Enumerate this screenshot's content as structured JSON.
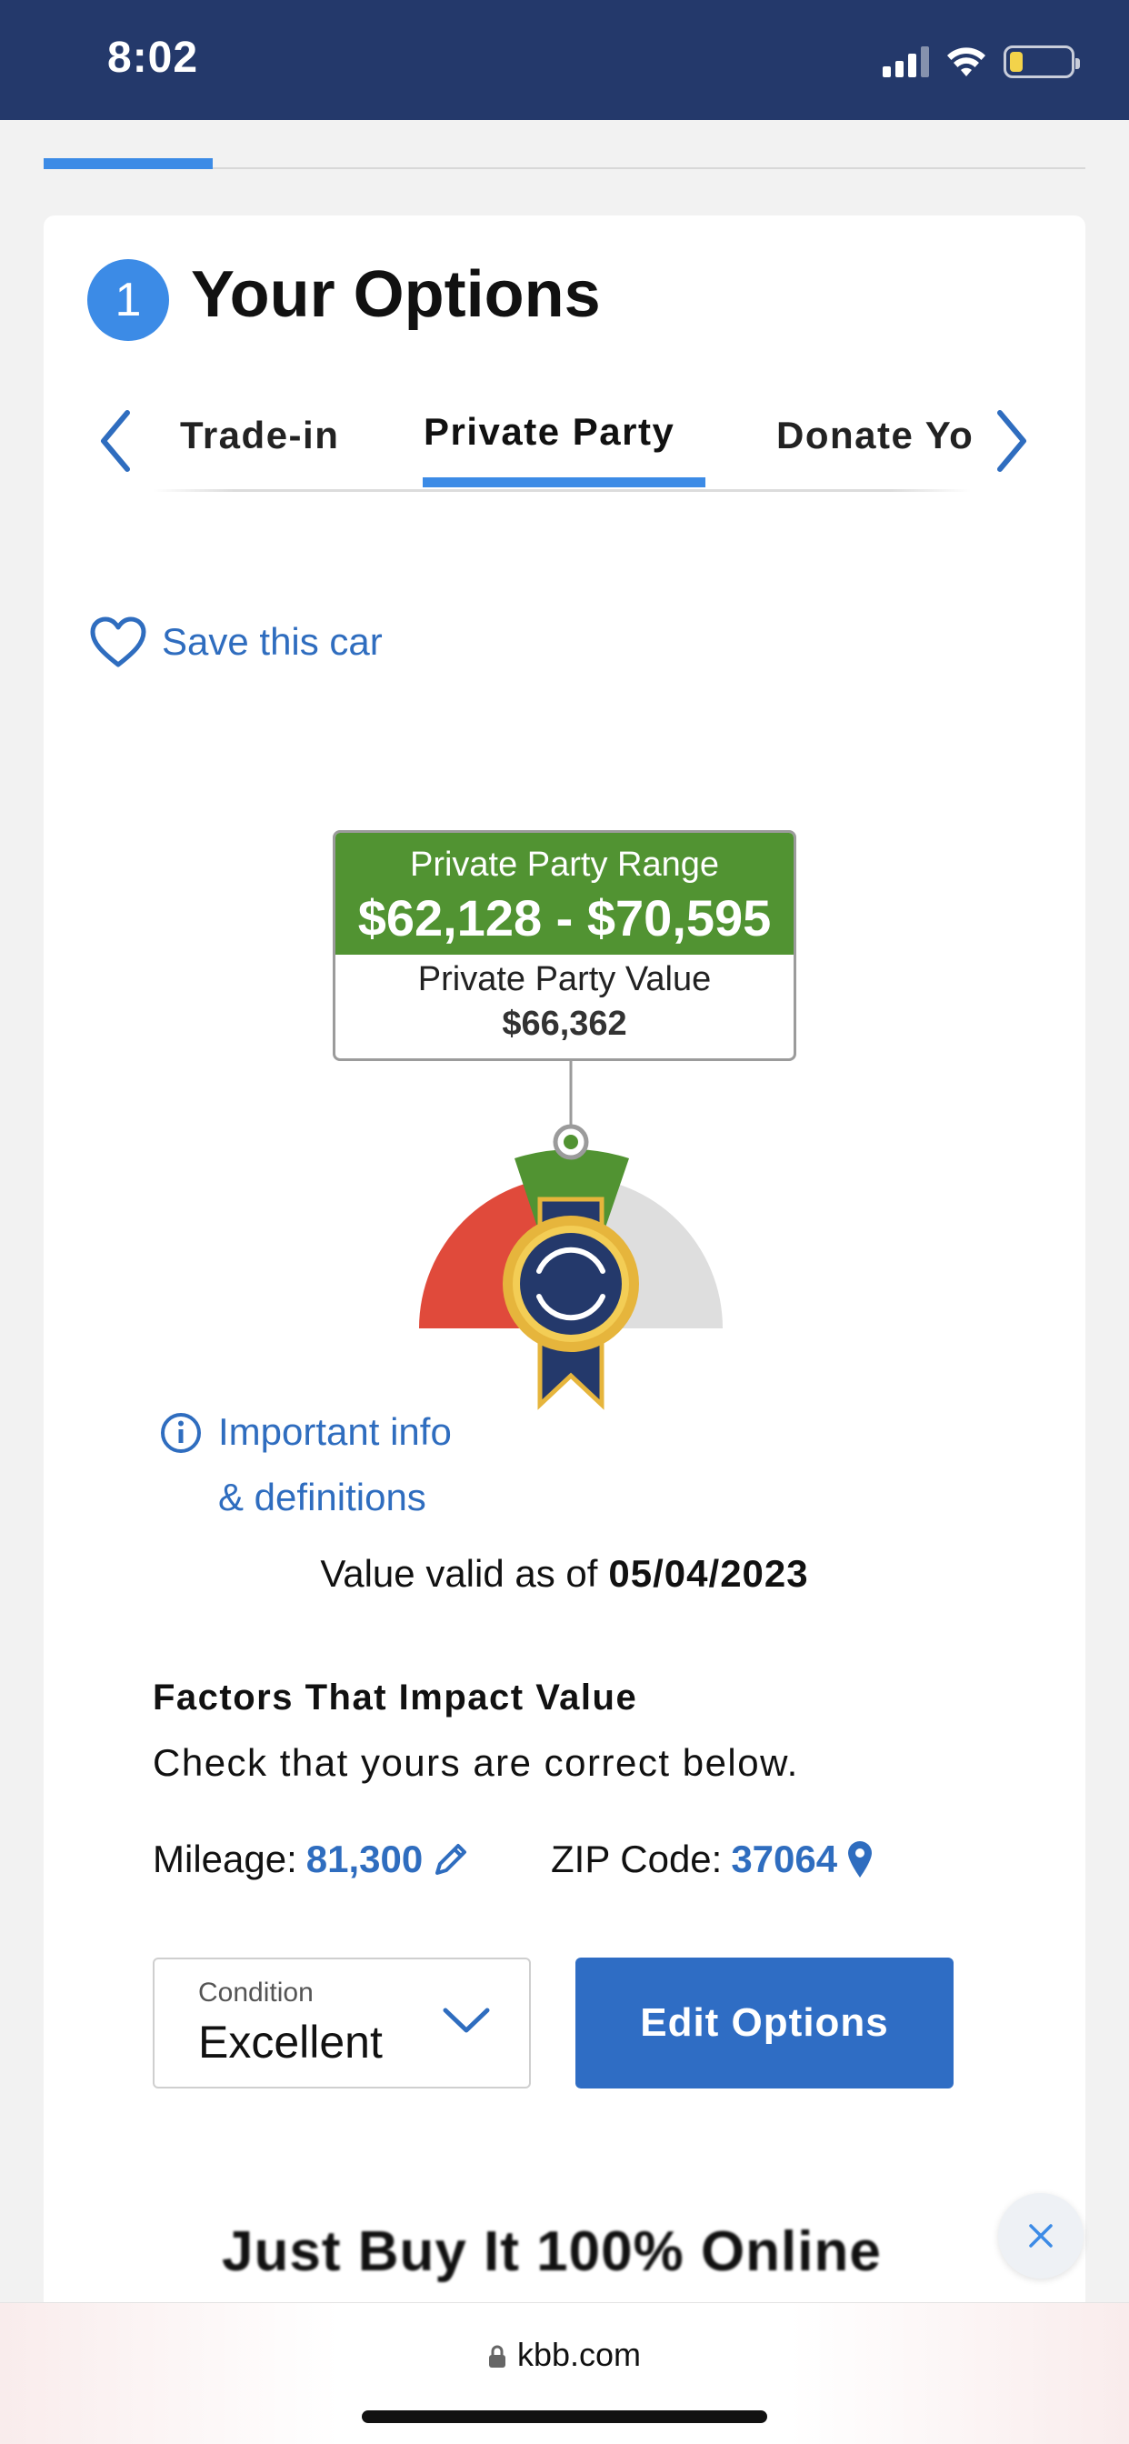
{
  "status_bar": {
    "time": "8:02",
    "background": "#24396b"
  },
  "section": {
    "step_number": "1",
    "title": "Your Options"
  },
  "tabs": [
    {
      "label": "Trade-in",
      "active": false
    },
    {
      "label": "Private Party",
      "active": true
    },
    {
      "label": "Donate Yo",
      "active": false
    }
  ],
  "save_link": {
    "label": "Save this car",
    "icon": "heart-icon"
  },
  "value_box": {
    "range_label": "Private Party Range",
    "range_value": "$62,128 - $70,595",
    "value_label": "Private Party Value",
    "value_amount": "$66,362",
    "accent": "#519332"
  },
  "info_link": {
    "line1": "Important info",
    "line2": "& definitions"
  },
  "valid": {
    "label": "Value valid as of",
    "date": "05/04/2023"
  },
  "factors": {
    "title": "Factors That Impact Value",
    "subtitle": "Check that yours are correct below.",
    "mileage_label": "Mileage:",
    "mileage_value": "81,300",
    "zip_label": "ZIP Code:",
    "zip_value": "37064"
  },
  "condition": {
    "label": "Condition",
    "value": "Excellent"
  },
  "edit_options_label": "Edit Options",
  "promo": "Just Buy It 100% Online",
  "browser": {
    "url": "kbb.com"
  },
  "colors": {
    "primary": "#2f6dc4",
    "link": "#2f6dbf",
    "accent_blue": "#3c8be6",
    "gauge_red": "#e04a3b",
    "gauge_green": "#519332",
    "gauge_gray": "#dedede"
  }
}
